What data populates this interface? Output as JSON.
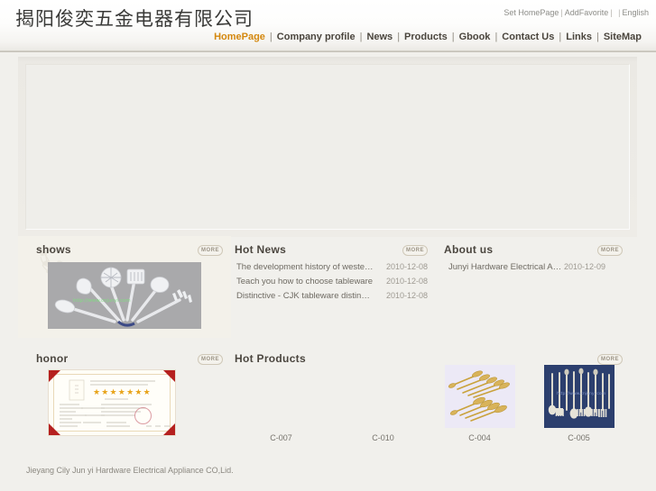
{
  "header": {
    "brand": "揭阳俊奕五金电器有限公司",
    "toplinks": [
      {
        "label": "Set HomePage"
      },
      {
        "label": "AddFavorite"
      },
      {
        "label": "English"
      }
    ],
    "nav": [
      {
        "label": "HomePage",
        "active": true
      },
      {
        "label": "Company profile",
        "active": false
      },
      {
        "label": "News",
        "active": false
      },
      {
        "label": "Products",
        "active": false
      },
      {
        "label": "Gbook",
        "active": false
      },
      {
        "label": "Contact Us",
        "active": false
      },
      {
        "label": "Links",
        "active": false
      },
      {
        "label": "SiteMap",
        "active": false
      }
    ],
    "accent_color": "#d4880f",
    "nav_color": "#4a453d"
  },
  "banner": {
    "alt": "banner-placeholder"
  },
  "shows": {
    "title": "shows",
    "more_label": "MORE",
    "image_alt": "kitchen-utensil-set",
    "watermark": "http://www.cnjunyi.com"
  },
  "hot_news": {
    "title": "Hot News",
    "more_label": "MORE",
    "items": [
      {
        "title": "The development history of western ta...",
        "date": "2010-12-08"
      },
      {
        "title": "Teach you how to choose tableware",
        "date": "2010-12-08"
      },
      {
        "title": "Distinctive - CJK tableware distinction",
        "date": "2010-12-08"
      }
    ]
  },
  "about_us": {
    "title": "About us",
    "more_label": "MORE",
    "items": [
      {
        "title": "Junyi Hardware Electrical Applianc...",
        "date": "2010-12-09"
      }
    ]
  },
  "honor": {
    "title": "honor",
    "more_label": "MORE",
    "image_alt": "certificate-of-honor",
    "stars": "★★★★★★★"
  },
  "hot_products": {
    "title": "Hot Products",
    "more_label": "MORE",
    "items": [
      {
        "code": "C-007",
        "has_image": false,
        "bg": "#f1f0ec"
      },
      {
        "code": "C-010",
        "has_image": false,
        "bg": "#f1f0ec"
      },
      {
        "code": "C-004",
        "has_image": true,
        "bg": "#ece9f6"
      },
      {
        "code": "C-005",
        "has_image": true,
        "bg": "#2c3f6e"
      }
    ]
  },
  "footer": {
    "text": "Jieyang Cily Jun yi Hardware Electrical Appliance CO,Lid."
  }
}
